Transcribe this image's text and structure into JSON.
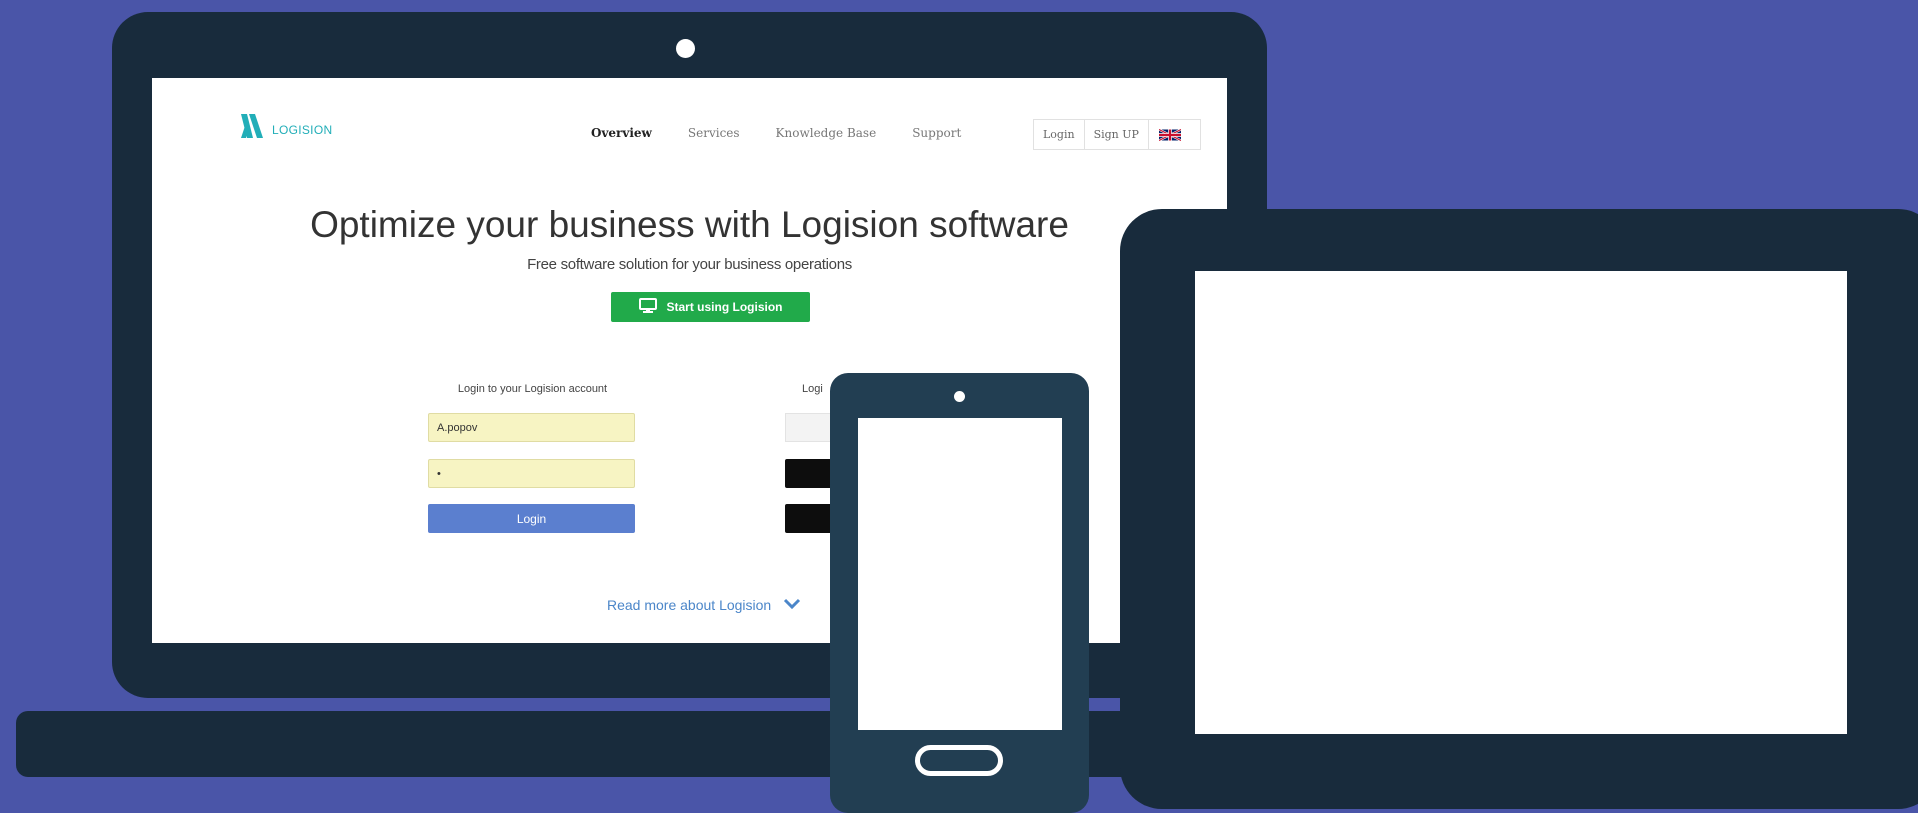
{
  "colors": {
    "background": "#4a55a8",
    "device_frame": "#182b3c",
    "phone_frame": "#223e52",
    "brand_teal": "#22aeb8",
    "cta_green": "#21aa4a",
    "login_blue": "#5b7fcf",
    "link_blue": "#4b86c9"
  },
  "site": {
    "brand": {
      "name": "LOGISION",
      "icon": "logision-logo-icon"
    },
    "nav": [
      {
        "label": "Overview",
        "active": true
      },
      {
        "label": "Services",
        "active": false
      },
      {
        "label": "Knowledge Base",
        "active": false
      },
      {
        "label": "Support",
        "active": false
      }
    ],
    "auth": {
      "login": "Login",
      "signup": "Sign UP",
      "flag_icon": "uk-flag-icon"
    },
    "hero": {
      "title": "Optimize your business with Logision software",
      "subtitle": "Free software solution for your business operations",
      "cta_label": "Start using Logision",
      "cta_icon": "monitor-icon"
    },
    "login_form": {
      "heading": "Login to your Logision account",
      "username_value": "A.popov",
      "password_value": "•",
      "button_label": "Login"
    },
    "alt_login": {
      "heading_visible": "Logi"
    },
    "read_more": {
      "label": "Read more about Logision",
      "icon": "chevron-down-icon"
    }
  }
}
